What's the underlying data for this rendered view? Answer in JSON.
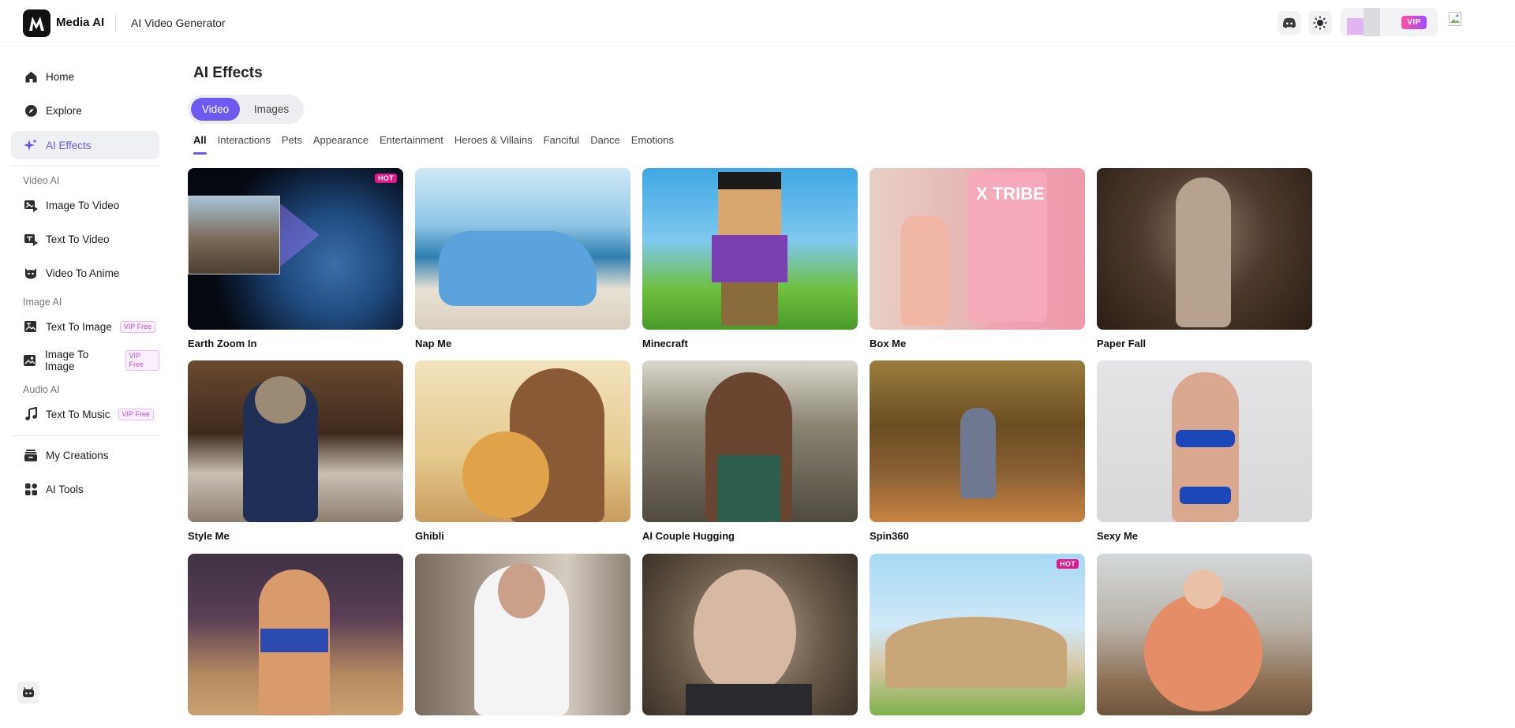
{
  "header": {
    "logo_text": "Media AI",
    "page_context": "AI Video Generator",
    "vip_badge": "VIP",
    "icons": [
      "discord-icon",
      "theme-toggle-icon",
      "avatar"
    ]
  },
  "sidebar": {
    "items": [
      {
        "label": "Home",
        "icon": "home-icon"
      },
      {
        "label": "Explore",
        "icon": "compass-icon"
      },
      {
        "label": "AI Effects",
        "icon": "sparkle-icon",
        "active": true
      }
    ],
    "groups": [
      {
        "title": "Video AI",
        "items": [
          {
            "label": "Image To Video",
            "icon": "image-video-icon"
          },
          {
            "label": "Text To Video",
            "icon": "text-video-icon"
          },
          {
            "label": "Video To Anime",
            "icon": "anime-icon"
          }
        ]
      },
      {
        "title": "Image AI",
        "items": [
          {
            "label": "Text To Image",
            "icon": "text-image-icon",
            "badge": "VIP Free"
          },
          {
            "label": "Image To Image",
            "icon": "image-image-icon",
            "badge": "VIP Free"
          }
        ]
      },
      {
        "title": "Audio AI",
        "items": [
          {
            "label": "Text To Music",
            "icon": "music-icon",
            "badge": "VIP Free"
          }
        ]
      }
    ],
    "bottom_items": [
      {
        "label": "My Creations",
        "icon": "creations-icon"
      },
      {
        "label": "AI Tools",
        "icon": "tools-icon"
      }
    ]
  },
  "main": {
    "title": "AI Effects",
    "segments": [
      "Video",
      "Images"
    ],
    "active_segment": "Video",
    "tabs": [
      "All",
      "Interactions",
      "Pets",
      "Appearance",
      "Entertainment",
      "Heroes & Villains",
      "Fanciful",
      "Dance",
      "Emotions"
    ],
    "active_tab": "All",
    "cards": [
      {
        "label": "Earth Zoom In",
        "hot": true
      },
      {
        "label": "Nap Me",
        "hot": false
      },
      {
        "label": "Minecraft",
        "hot": false
      },
      {
        "label": "Box Me",
        "hot": false
      },
      {
        "label": "Paper Fall",
        "hot": false
      },
      {
        "label": "Style Me",
        "hot": false
      },
      {
        "label": "Ghibli",
        "hot": false
      },
      {
        "label": "AI Couple Hugging",
        "hot": false
      },
      {
        "label": "Spin360",
        "hot": false
      },
      {
        "label": "Sexy Me",
        "hot": false
      },
      {
        "label": "",
        "hot": false
      },
      {
        "label": "",
        "hot": false
      },
      {
        "label": "",
        "hot": false
      },
      {
        "label": "",
        "hot": true
      },
      {
        "label": "",
        "hot": false
      }
    ],
    "hot_badge": "HOT",
    "box_text": "X TRIBE"
  }
}
